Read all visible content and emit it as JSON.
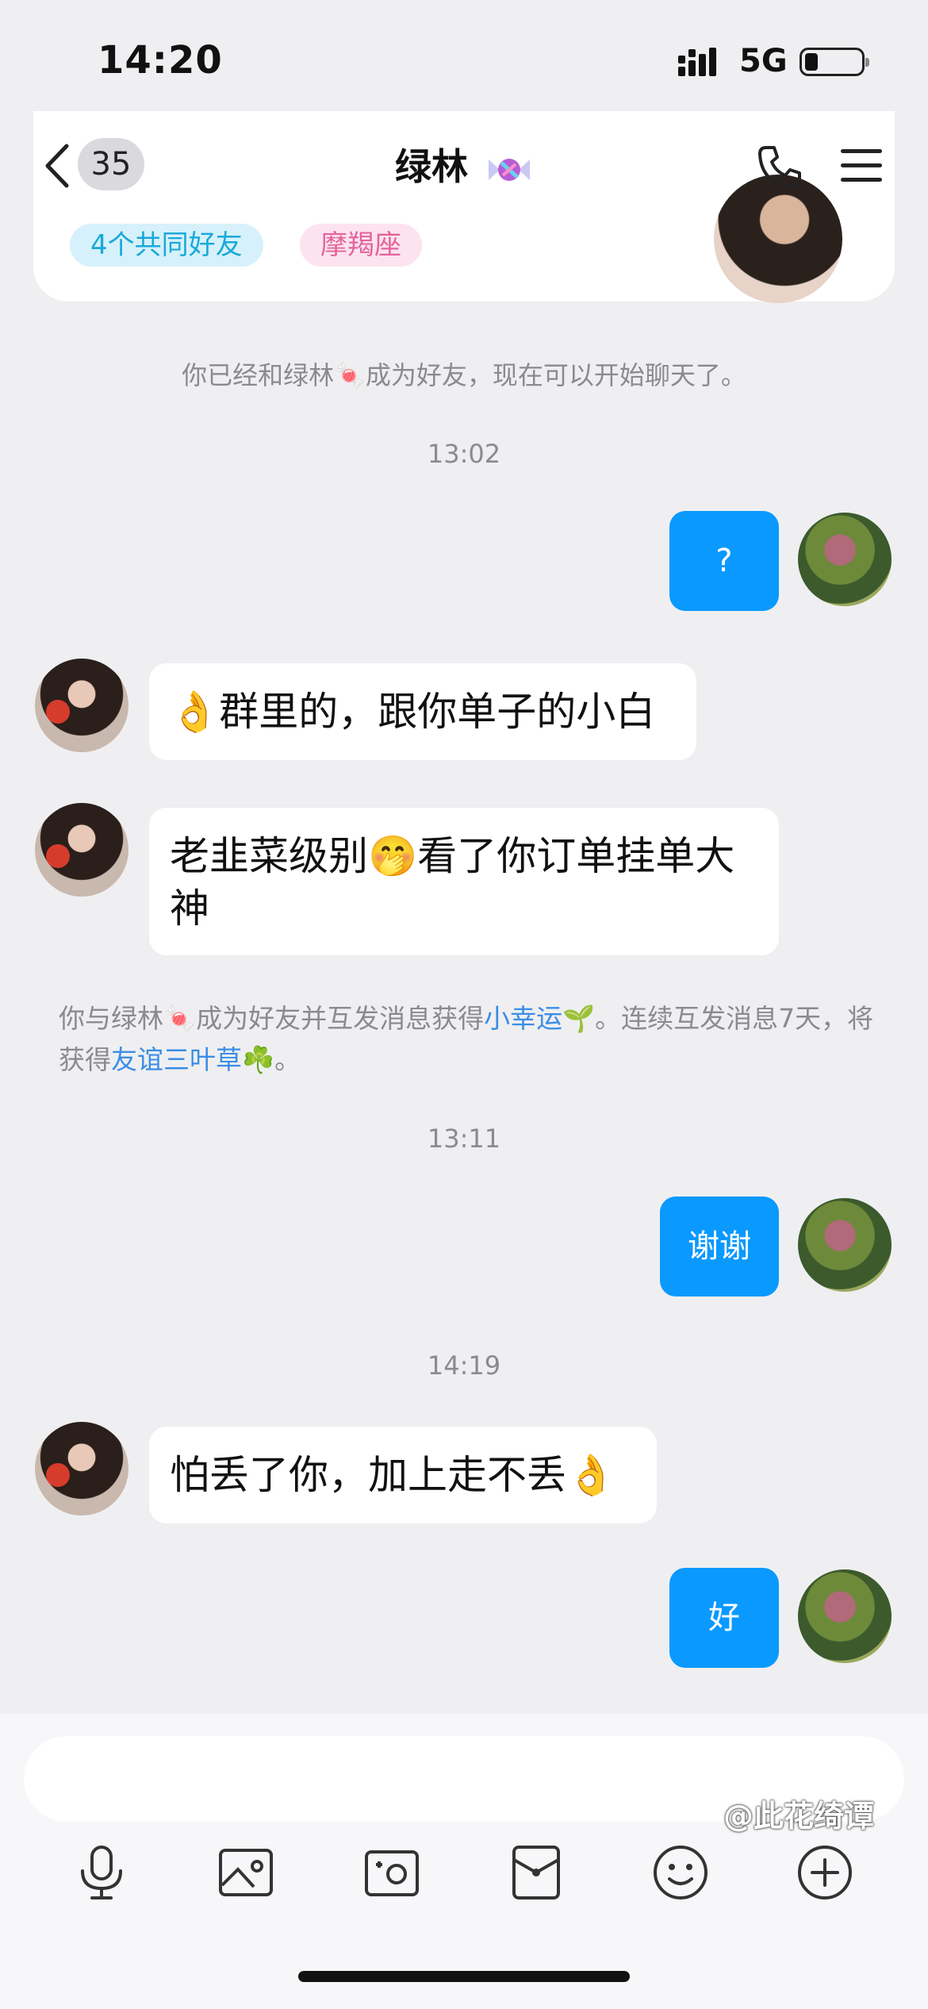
{
  "status_bar": {
    "time": "14:20",
    "network": "5G"
  },
  "header": {
    "back_count": "35",
    "title": "绿林"
  },
  "profile_card": {
    "tags": [
      "4个共同好友",
      "摩羯座"
    ]
  },
  "messages": {
    "system_friend": "你已经和绿林🍬成为好友，现在可以开始聊天了。",
    "ts1": "13:02",
    "me1": "?",
    "them1": "👌群里的，跟你单子的小白",
    "them2": "老韭菜级别🤭看了你订单挂单大神",
    "notice_part1": "你与绿林🍬成为好友并互发消息获得",
    "notice_link1": "小幸运",
    "notice_part2": "🌱。连续互发消息7天，将获得",
    "notice_link2": "友谊三叶草",
    "notice_part3": "☘️。",
    "ts2": "13:11",
    "me2": "谢谢",
    "ts3": "14:19",
    "them3": "怕丢了你，加上走不丢👌",
    "me3": "好"
  },
  "watermark": "@此花绮谭",
  "toolbar_icons": [
    "microphone-icon",
    "image-icon",
    "camera-icon",
    "red-packet-icon",
    "emoji-icon",
    "plus-icon"
  ],
  "colors": {
    "accent_blue": "#0a99ff",
    "link": "#3a8ee6"
  }
}
